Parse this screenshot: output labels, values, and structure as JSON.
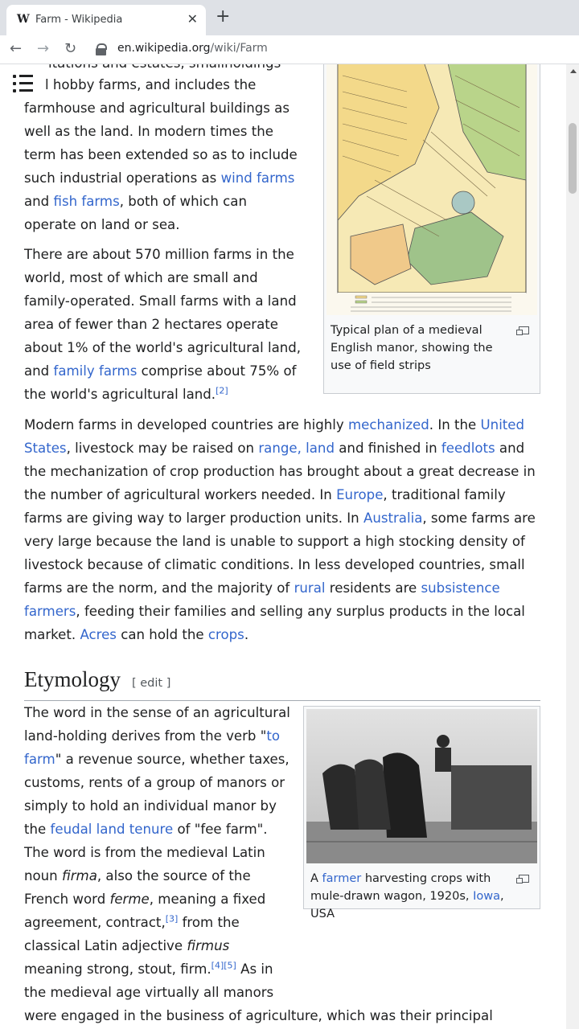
{
  "browser": {
    "tab_title": "Farm - Wikipedia",
    "tab_icon_label": "W",
    "url_host": "en.wikipedia.org",
    "url_path": "/wiki/Farm"
  },
  "article": {
    "cut_line": "itations and estates, smallholdings",
    "p1_a": " l hobby farms, and includes the farmhouse and agricultural buildings as well as the land. In modern times the term has been extended so as to include such industrial operations as ",
    "p1_link1": "wind farms",
    "p1_b": " and ",
    "p1_link2": "fish farms",
    "p1_c": ", both of which can operate on land or sea.",
    "p2_a": "There are about 570 million farms in the world, most of which are small and family-operated. Small farms with a land area of fewer than 2 hectares operate about 1% of the world's agricultural land, and ",
    "p2_link1": "family farms",
    "p2_b": " comprise about 75% of the world's agricultural land.",
    "p2_ref": "[2]",
    "p3_a": "Modern farms in developed countries are highly ",
    "p3_link1": "mechanized",
    "p3_b": ". In the ",
    "p3_link2": "United States",
    "p3_c": ", livestock may be raised on ",
    "p3_link3": "range, land",
    "p3_d": " and finished in ",
    "p3_link4": "feedlots",
    "p3_e": " and the mechanization of crop production has brought about a great decrease in the number of agricultural workers needed. In ",
    "p3_link5": "Europe",
    "p3_f": ", traditional family farms are giving way to larger production units. In ",
    "p3_link6": "Australia",
    "p3_g": ", some farms are very large because the land is unable to support a high stocking density of livestock because of climatic conditions. In less developed countries, small farms are the norm, and the majority of ",
    "p3_link7": "rural",
    "p3_h": " residents are ",
    "p3_link8": "subsistence farmers",
    "p3_i": ", feeding their families and selling any surplus products in the local market. ",
    "p3_link9": "Acres",
    "p3_j": " can hold the ",
    "p3_link10": "crops",
    "p3_k": "."
  },
  "section": {
    "heading": "Etymology",
    "edit_label": "[ edit ]",
    "e_a": "The word in the sense of an agricultural land-holding derives from the verb \"",
    "e_link1": "to farm",
    "e_b": "\" a revenue source, whether taxes, customs, rents of a group of manors or simply to hold an individual manor by the ",
    "e_link2": "feudal land tenure",
    "e_c": " of \"fee farm\". The word is from the medieval Latin noun ",
    "e_i1": "firma",
    "e_d": ", also the source of the French word ",
    "e_i2": "ferme",
    "e_e": ", meaning a fixed agreement, contract,",
    "e_ref1": "[3]",
    "e_f": " from the classical Latin adjective ",
    "e_i3": "firmus",
    "e_g": " meaning strong, stout, firm.",
    "e_ref2": "[4]",
    "e_ref3": "[5]",
    "e_h": " As in the medieval age virtually all manors were engaged in the business of agriculture, which was their principal revenue source, so to hold a manor by the tenure of \"fee farm\" became synonymous with the practice of"
  },
  "figures": {
    "map_caption": "Typical plan of a medieval English manor, showing the use of field strips",
    "photo_caption_a": "A ",
    "photo_caption_link1": "farmer",
    "photo_caption_b": " harvesting crops with mule-drawn wagon, 1920s, ",
    "photo_caption_link2": "Iowa",
    "photo_caption_c": ", USA"
  },
  "icons": [
    "back-arrow-icon",
    "forward-arrow-icon",
    "reload-icon",
    "lock-icon",
    "toc-list-icon",
    "magnify-icon",
    "close-icon",
    "plus-icon"
  ]
}
